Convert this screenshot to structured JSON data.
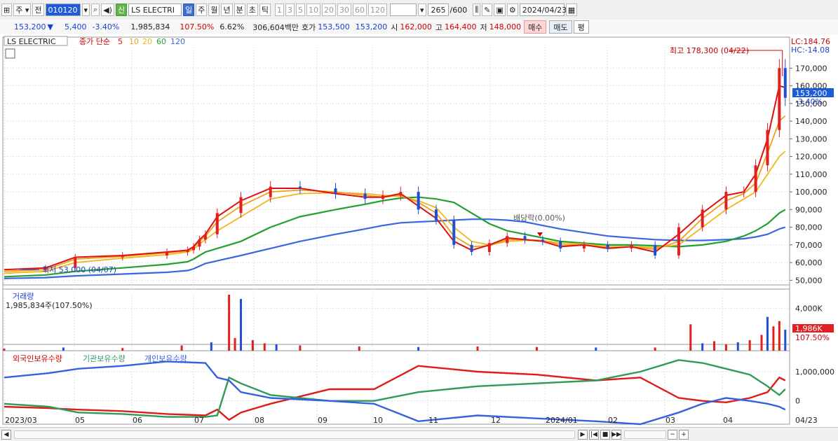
{
  "toolbar": {
    "market": "주",
    "prev": "전",
    "code": "010120",
    "badge": "신",
    "name": "LS ELECTRI",
    "periods": [
      "일",
      "주",
      "월",
      "년",
      "분",
      "초",
      "틱"
    ],
    "minutes": [
      "1",
      "3",
      "5",
      "10",
      "20",
      "30",
      "60",
      "120"
    ],
    "count": "265",
    "count_total": "/600",
    "date": "2024/04/23"
  },
  "quote": {
    "price": "153,200",
    "arrow": "▼",
    "change": "5,400",
    "change_pct": "-3.40%",
    "volume": "1,985,834",
    "vol_ratio": "107.50%",
    "turnover": "6.62%",
    "amount": "306,604백만",
    "hoga_label": "호가",
    "ask": "153,500",
    "bid": "153,200",
    "open_label": "시",
    "open": "162,000",
    "high_label": "고",
    "high": "164,400",
    "low_label": "저",
    "low": "148,000",
    "buy": "매수",
    "sell": "매도",
    "eval": "평"
  },
  "price_panel": {
    "title": "LS ELECTRIC",
    "ma_label": "종가 단순",
    "ma_periods": [
      "5",
      "10",
      "20",
      "60",
      "120"
    ],
    "lc": "LC:184.76",
    "hc": "HC:-14.08",
    "current": "153,200",
    "current_pct": "-3.40%",
    "max_note": "최고 178,300 (04/22)",
    "min_note": "최저 53,000 (04/07)",
    "dividend_note": "배당락(0.00%)"
  },
  "volume_panel": {
    "title": "거래량",
    "value": "1,985,834주(107.50%)",
    "current": "1,986K",
    "current_pct": "107.50%"
  },
  "holding_panel": {
    "series": [
      "외국인보유수량",
      "기관보유수량",
      "개인보유수량"
    ]
  },
  "colors": {
    "up": "#e31e1e",
    "down": "#1f4fd8",
    "ma5": "#e01010",
    "ma10": "#e8a31b",
    "ma20": "#f0b520",
    "ma60": "#22a030",
    "ma120": "#3a66e0",
    "foreign": "#e11a1a",
    "institution": "#2f9a5a",
    "individual": "#3560e0"
  },
  "chart_data": [
    {
      "type": "line",
      "name": "price",
      "y_ticks": [
        50000,
        60000,
        70000,
        80000,
        90000,
        100000,
        110000,
        120000,
        130000,
        140000,
        150000,
        160000,
        170000
      ],
      "y_tick_labels": [
        "50,000",
        "60,000",
        "70,000",
        "80,000",
        "90,000",
        "100,000",
        "110,000",
        "120,000",
        "130,000",
        "140,000",
        "150,000",
        "160,000",
        "170,000"
      ],
      "ylim": [
        45000,
        182000
      ],
      "x_labels": [
        "2023/03",
        "05",
        "06",
        "07",
        "08",
        "09",
        "10",
        "11",
        "12",
        "2024/01",
        "02",
        "03",
        "04",
        "04/23"
      ],
      "x": [
        0,
        14,
        24,
        40,
        55,
        62,
        64,
        66,
        68,
        72,
        80,
        90,
        100,
        112,
        122,
        128,
        134,
        140,
        146,
        152,
        158,
        164,
        170,
        176,
        182,
        188,
        196,
        204,
        212,
        220,
        228,
        236,
        244,
        250,
        254,
        258,
        262,
        264
      ],
      "close": [
        56000,
        57000,
        63000,
        64000,
        66000,
        67000,
        69000,
        73000,
        76000,
        88000,
        97000,
        103000,
        102000,
        99000,
        96000,
        98000,
        100000,
        90000,
        84000,
        70000,
        66000,
        71000,
        75000,
        73000,
        72000,
        68000,
        70000,
        68000,
        70000,
        64000,
        80000,
        90000,
        100000,
        100000,
        115000,
        135000,
        170000,
        153200
      ],
      "series": [
        {
          "name": "5",
          "values": [
            56000,
            57000,
            63000,
            64000,
            66000,
            67000,
            69000,
            73000,
            76000,
            86000,
            95000,
            102000,
            102000,
            99000,
            97000,
            97000,
            99000,
            92000,
            85000,
            72000,
            67000,
            70000,
            74000,
            73000,
            72000,
            69000,
            70000,
            68000,
            69000,
            66000,
            76000,
            88000,
            98000,
            100000,
            110000,
            130000,
            160000,
            159000
          ]
        },
        {
          "name": "10",
          "values": [
            55000,
            56000,
            62000,
            63500,
            65500,
            66500,
            68500,
            72000,
            75000,
            83000,
            92000,
            100000,
            101000,
            100000,
            98000,
            97000,
            98000,
            94000,
            88000,
            75000,
            69000,
            69500,
            73000,
            73000,
            72500,
            70000,
            70000,
            68500,
            69000,
            67500,
            72000,
            85000,
            95000,
            99000,
            105000,
            122000,
            140000,
            143000
          ]
        },
        {
          "name": "20",
          "values": [
            54000,
            55000,
            60000,
            62500,
            64500,
            66000,
            67500,
            70500,
            73000,
            78000,
            86000,
            96000,
            99000,
            99500,
            99000,
            98000,
            97500,
            95000,
            91000,
            80000,
            72000,
            70000,
            72000,
            72500,
            72500,
            71000,
            70500,
            69000,
            69000,
            68500,
            70000,
            80000,
            90000,
            96000,
            100000,
            110000,
            120000,
            123000
          ]
        },
        {
          "name": "60",
          "values": [
            52000,
            53000,
            55000,
            57000,
            59000,
            60500,
            62000,
            64000,
            66000,
            68000,
            72000,
            80000,
            86000,
            90000,
            93000,
            95000,
            96500,
            97000,
            96000,
            94000,
            88000,
            82000,
            78000,
            76000,
            74000,
            72000,
            71000,
            70000,
            70000,
            69500,
            69000,
            70000,
            72000,
            75000,
            78000,
            82000,
            88000,
            90000
          ]
        },
        {
          "name": "120",
          "values": [
            51000,
            51500,
            52500,
            53500,
            54500,
            55500,
            56500,
            58000,
            59500,
            61000,
            64000,
            68000,
            72000,
            76000,
            79000,
            81000,
            82500,
            83000,
            83500,
            84000,
            84500,
            84500,
            84000,
            83000,
            81000,
            79000,
            77000,
            75000,
            74000,
            73000,
            72500,
            72500,
            73000,
            73500,
            74500,
            76000,
            79000,
            80000
          ]
        }
      ]
    },
    {
      "type": "bar",
      "name": "volume",
      "y_ticks": [
        4000000
      ],
      "y_tick_labels": [
        "4,000K"
      ],
      "ylim": [
        0,
        5300000
      ],
      "x": [
        0,
        20,
        40,
        60,
        70,
        76,
        78,
        80,
        84,
        88,
        92,
        100,
        120,
        140,
        160,
        180,
        200,
        220,
        232,
        236,
        240,
        244,
        248,
        252,
        256,
        258,
        260,
        262,
        264
      ],
      "values": [
        200000,
        300000,
        250000,
        500000,
        800000,
        5300000,
        1200000,
        4900000,
        1000000,
        700000,
        600000,
        500000,
        400000,
        350000,
        400000,
        350000,
        300000,
        300000,
        2500000,
        700000,
        900000,
        600000,
        800000,
        1000000,
        1500000,
        3200000,
        2300000,
        2800000,
        1986000
      ]
    },
    {
      "type": "line",
      "name": "holdings",
      "y_ticks": [
        0,
        1000000
      ],
      "y_tick_labels": [
        "0",
        "1,000,000"
      ],
      "ylim": [
        -800000,
        1600000
      ],
      "x_labels": [
        "2023/03",
        "05",
        "06",
        "07",
        "08",
        "09",
        "10",
        "11",
        "12",
        "2024/01",
        "02",
        "03",
        "04",
        "04/23"
      ],
      "x": [
        0,
        15,
        25,
        40,
        55,
        68,
        72,
        76,
        80,
        90,
        110,
        125,
        140,
        160,
        180,
        200,
        215,
        228,
        236,
        244,
        252,
        258,
        262,
        264
      ],
      "series": [
        {
          "name": "외국인보유수량",
          "values": [
            -200000,
            -250000,
            -300000,
            -350000,
            -450000,
            -500000,
            -300000,
            -650000,
            -400000,
            -100000,
            400000,
            400000,
            1200000,
            1000000,
            900000,
            700000,
            800000,
            100000,
            0,
            -50000,
            100000,
            300000,
            800000,
            700000
          ]
        },
        {
          "name": "기관보유수량",
          "values": [
            -100000,
            -200000,
            -400000,
            -450000,
            -550000,
            -550000,
            -500000,
            800000,
            600000,
            200000,
            0,
            0,
            300000,
            500000,
            600000,
            700000,
            1000000,
            1400000,
            1300000,
            1100000,
            900000,
            500000,
            200000,
            400000
          ]
        },
        {
          "name": "개인보유수량",
          "values": [
            800000,
            950000,
            1100000,
            1200000,
            1350000,
            1300000,
            800000,
            700000,
            300000,
            100000,
            0,
            -100000,
            -700000,
            -500000,
            -600000,
            -700000,
            -800000,
            -400000,
            -100000,
            100000,
            0,
            -100000,
            -200000,
            -300000
          ]
        }
      ]
    }
  ]
}
